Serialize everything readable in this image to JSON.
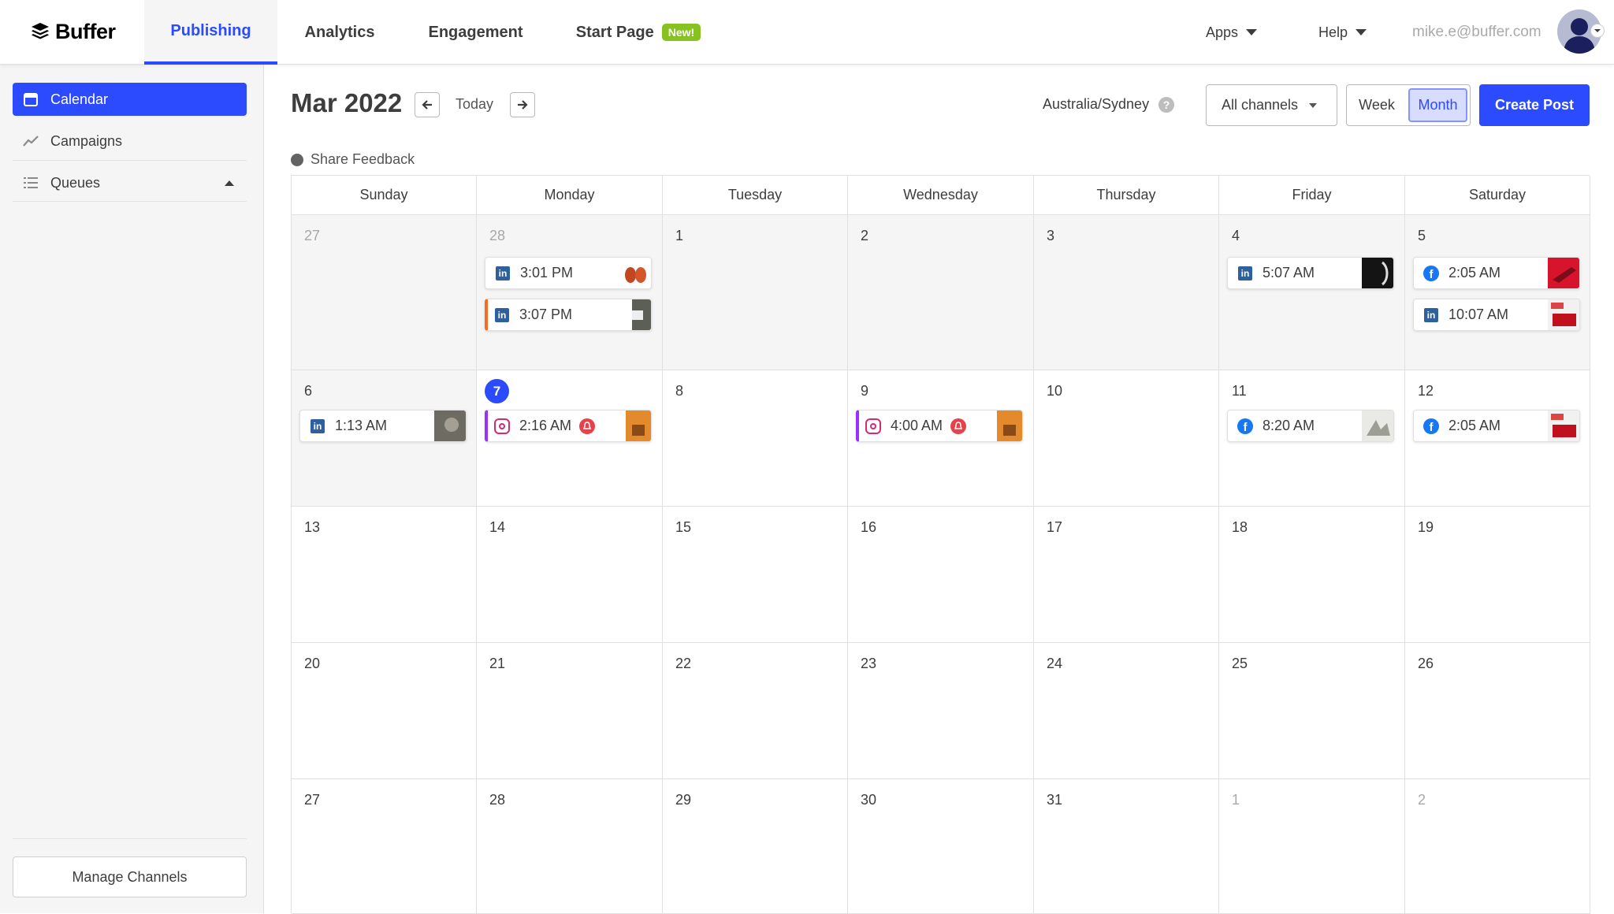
{
  "nav": {
    "logo": "Buffer",
    "tabs": [
      {
        "label": "Publishing"
      },
      {
        "label": "Analytics"
      },
      {
        "label": "Engagement"
      },
      {
        "label": "Start Page",
        "badge": "New!"
      }
    ],
    "apps": "Apps",
    "help": "Help",
    "email": "mike.e@buffer.com"
  },
  "sidebar": {
    "items": [
      {
        "label": "Calendar",
        "icon": "calendar-icon"
      },
      {
        "label": "Campaigns",
        "icon": "trend-icon"
      },
      {
        "label": "Queues",
        "icon": "list-icon"
      }
    ],
    "manage": "Manage Channels"
  },
  "toolbar": {
    "month": "Mar 2022",
    "today": "Today",
    "timezone": "Australia/Sydney",
    "channels": "All channels",
    "week": "Week",
    "month_view": "Month",
    "create": "Create Post",
    "feedback": "Share Feedback"
  },
  "calendar": {
    "weekdays": [
      "Sunday",
      "Monday",
      "Tuesday",
      "Wednesday",
      "Thursday",
      "Friday",
      "Saturday"
    ],
    "weeks": [
      [
        "27",
        "28",
        "1",
        "2",
        "3",
        "4",
        "5"
      ],
      [
        "6",
        "7",
        "8",
        "9",
        "10",
        "11",
        "12"
      ],
      [
        "13",
        "14",
        "15",
        "16",
        "17",
        "18",
        "19"
      ],
      [
        "20",
        "21",
        "22",
        "23",
        "24",
        "25",
        "26"
      ],
      [
        "27",
        "28",
        "29",
        "30",
        "31",
        "1",
        "2"
      ]
    ],
    "posts": [
      {
        "time": "3:01 PM",
        "network": "linkedin"
      },
      {
        "time": "3:07 PM",
        "network": "linkedin"
      },
      {
        "time": "5:07 AM",
        "network": "linkedin"
      },
      {
        "time": "2:05 AM",
        "network": "facebook"
      },
      {
        "time": "10:07 AM",
        "network": "linkedin"
      },
      {
        "time": "1:13 AM",
        "network": "linkedin"
      },
      {
        "time": "2:16 AM",
        "network": "instagram"
      },
      {
        "time": "4:00 AM",
        "network": "instagram"
      },
      {
        "time": "8:20 AM",
        "network": "facebook"
      },
      {
        "time": "2:05 AM",
        "network": "facebook"
      }
    ]
  },
  "colors": {
    "brand": "#2c4bff",
    "new_badge": "#87c221",
    "linkedin": "#2e5f9e",
    "facebook": "#1877f2",
    "instagram": "#d62976"
  }
}
